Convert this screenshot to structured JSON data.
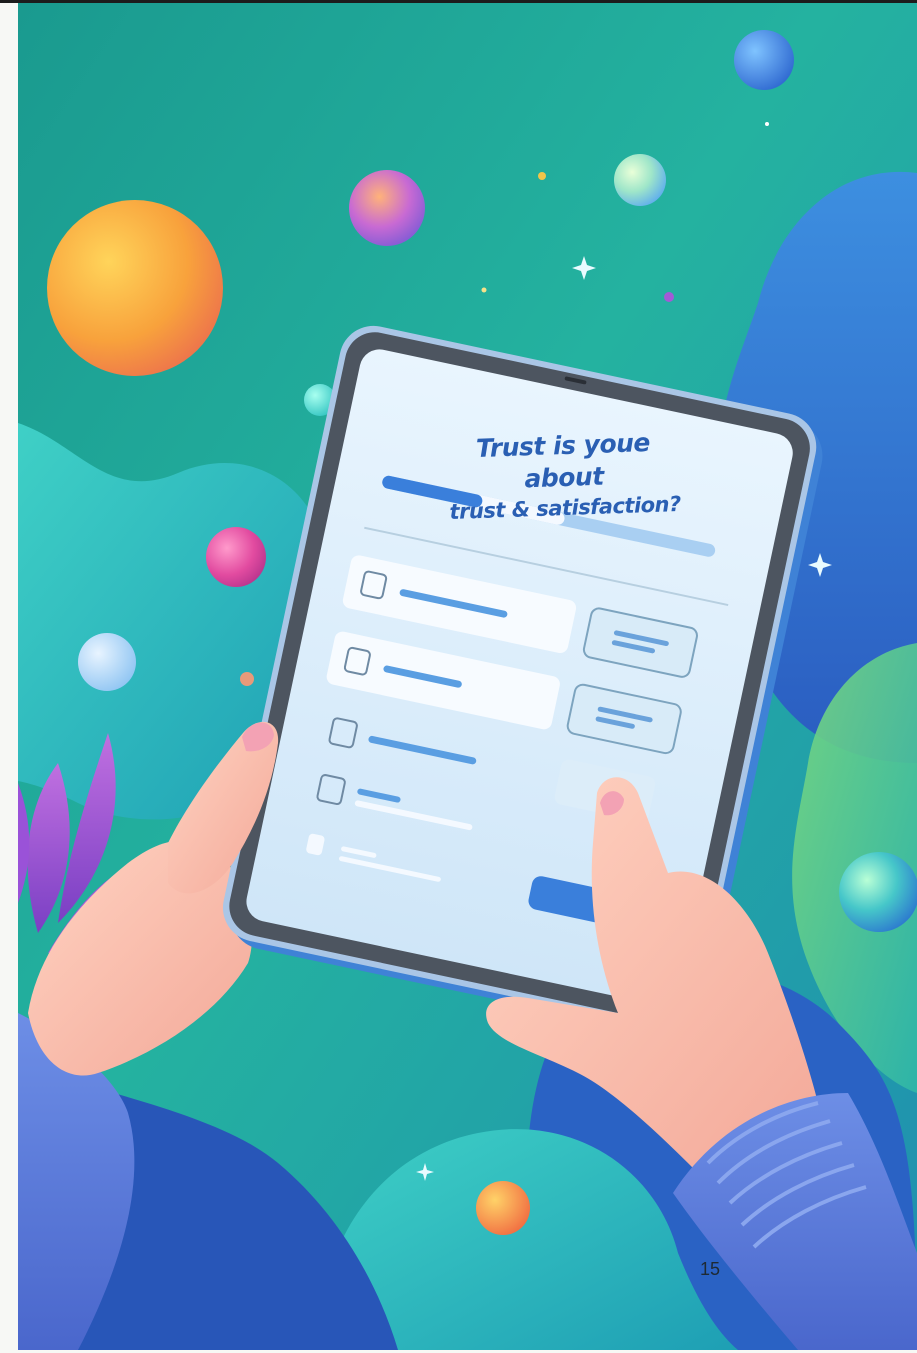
{
  "illustration": {
    "subject": "Hands holding a tablet showing a survey form",
    "background_colors": [
      "#1fae9a",
      "#2fc3b0",
      "#3f7fd6",
      "#2c5fb8"
    ],
    "accent_colors": [
      "#f7a23a",
      "#e8479a",
      "#8a5ad6",
      "#5aa9f0"
    ]
  },
  "tablet_screen": {
    "headline_line1": "Trust is youe about",
    "headline_line2": "trust & satisfaction?",
    "progress": 0.3,
    "primary_color": "#3a7fdb"
  },
  "page": {
    "number": "15"
  }
}
